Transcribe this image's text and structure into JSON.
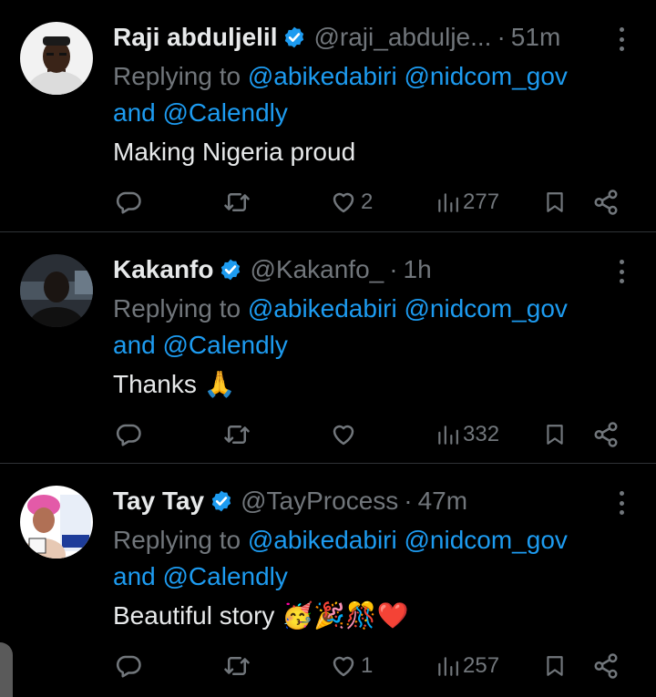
{
  "tweets": [
    {
      "name": "Raji abduljelil",
      "handle": "@raji_abdulje...",
      "time": "51m",
      "replying_prefix": "Replying to",
      "mentions": [
        "@abikedabiri",
        "@nidcom_gov"
      ],
      "and_text": "and",
      "mention_last": "@Calendly",
      "text": "Making Nigeria proud",
      "emojis": "",
      "likes": "2",
      "views": "277",
      "avatar_bg": "#f2f2f2"
    },
    {
      "name": "Kakanfo",
      "handle": "@Kakanfo_",
      "time": "1h",
      "replying_prefix": "Replying to",
      "mentions": [
        "@abikedabiri",
        "@nidcom_gov"
      ],
      "and_text": "and",
      "mention_last": "@Calendly",
      "text": "Thanks",
      "emojis": "🙏",
      "likes": "",
      "views": "332",
      "avatar_bg": "#2a2f36"
    },
    {
      "name": "Tay Tay",
      "handle": "@TayProcess",
      "time": "47m",
      "replying_prefix": "Replying to",
      "mentions": [
        "@abikedabiri",
        "@nidcom_gov"
      ],
      "and_text": "and",
      "mention_last": "@Calendly",
      "text": "Beautiful story",
      "emojis": "🥳🎉🎊❤️",
      "likes": "1",
      "views": "257",
      "avatar_bg": "#ffffff"
    }
  ],
  "colors": {
    "background": "#000000",
    "text": "#e7e9ea",
    "muted": "#71767b",
    "link": "#1d9bf0",
    "divider": "#2f3336",
    "verified": "#1d9bf0"
  },
  "icons": {
    "verified": "verified-badge-icon",
    "more": "more-vertical-icon",
    "reply": "reply-icon",
    "retweet": "retweet-icon",
    "like": "heart-icon",
    "views": "views-chart-icon",
    "bookmark": "bookmark-icon",
    "share": "share-icon"
  }
}
